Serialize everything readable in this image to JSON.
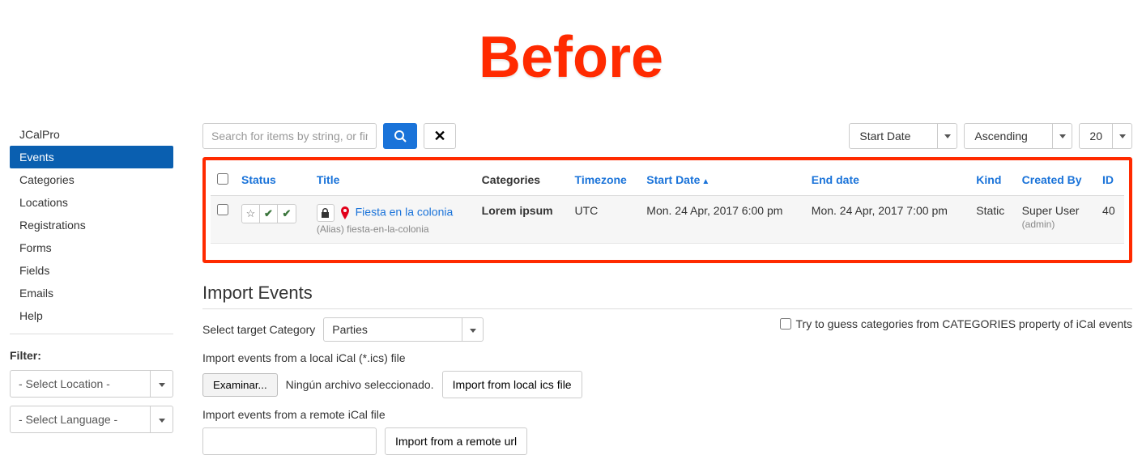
{
  "page_title": "Before",
  "sidebar": {
    "items": [
      {
        "label": "JCalPro",
        "name": "jcalpro"
      },
      {
        "label": "Events",
        "name": "events",
        "active": true
      },
      {
        "label": "Categories",
        "name": "categories"
      },
      {
        "label": "Locations",
        "name": "locations"
      },
      {
        "label": "Registrations",
        "name": "registrations"
      },
      {
        "label": "Forms",
        "name": "forms"
      },
      {
        "label": "Fields",
        "name": "fields"
      },
      {
        "label": "Emails",
        "name": "emails"
      },
      {
        "label": "Help",
        "name": "help"
      }
    ]
  },
  "filter": {
    "heading": "Filter:",
    "location": "- Select Location -",
    "language": "- Select Language -"
  },
  "toolbar": {
    "search_placeholder": "Search for items by string, or find an",
    "sort_field": "Start Date",
    "sort_dir": "Ascending",
    "page_size": "20"
  },
  "table": {
    "headers": {
      "status": "Status",
      "title": "Title",
      "categories": "Categories",
      "timezone": "Timezone",
      "start_date": "Start Date",
      "end_date": "End date",
      "kind": "Kind",
      "created_by": "Created By",
      "id": "ID"
    },
    "rows": [
      {
        "title": "Fiesta en la colonia",
        "alias": "(Alias) fiesta-en-la-colonia",
        "categories": "Lorem ipsum",
        "timezone": "UTC",
        "start_date": "Mon. 24 Apr, 2017 6:00 pm",
        "end_date": "Mon. 24 Apr, 2017 7:00 pm",
        "kind": "Static",
        "created_by": "Super User",
        "created_by_user": "(admin)",
        "id": "40"
      }
    ]
  },
  "import": {
    "heading": "Import Events",
    "target_label": "Select target Category",
    "target_value": "Parties",
    "guess_label": "Try to guess categories from CATEGORIES property of iCal events",
    "local_heading": "Import events from a local iCal (*.ics) file",
    "browse_label": "Examinar...",
    "file_status": "Ningún archivo seleccionado.",
    "local_button": "Import from local ics file",
    "remote_heading": "Import events from a remote iCal file",
    "remote_button": "Import from a remote url"
  }
}
